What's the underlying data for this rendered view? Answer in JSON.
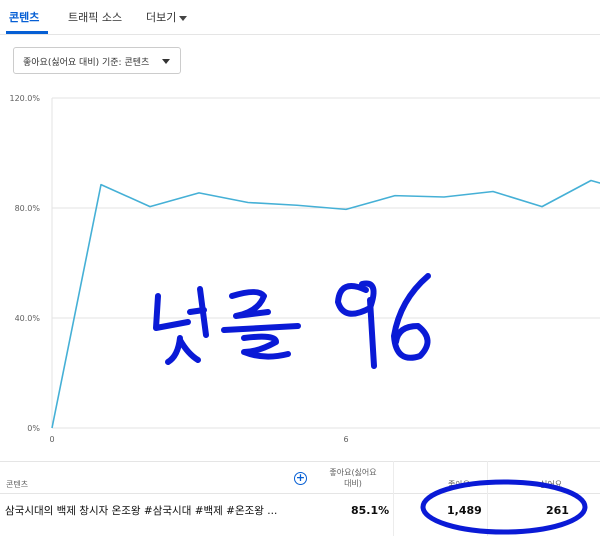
{
  "tabs": [
    {
      "label": "콘텐츠",
      "active": true
    },
    {
      "label": "트래픽 소스"
    },
    {
      "label": "더보기"
    }
  ],
  "dropdown": {
    "label": "좋아요(싫어요 대비) 기준: 콘텐츠"
  },
  "chart_data": {
    "type": "line",
    "x_ticks": [
      "0",
      "6"
    ],
    "y_ticks": [
      "0%",
      "40.0%",
      "80.0%",
      "120.0%"
    ],
    "ylim": [
      0,
      120
    ],
    "x": [
      0,
      1,
      2,
      3,
      4,
      5,
      6,
      7,
      8,
      9,
      10,
      11,
      12
    ],
    "values": [
      0,
      88.5,
      80.5,
      85.5,
      82,
      81,
      79.5,
      84.5,
      84,
      86,
      80.5,
      90,
      85
    ],
    "grid": true,
    "line_color": "#45b0d6"
  },
  "table": {
    "headers": {
      "content": "콘텐츠",
      "likes_ratio_line1": "좋아요(싫어요",
      "likes_ratio_line2": "대비)",
      "likes": "좋아요",
      "dislikes": "싫어요"
    },
    "add_button": "+",
    "row": {
      "title": "삼국시대의 백제 창시자 온조왕 #삼국시대 #백제 #온조왕 ...",
      "likes_ratio": "85.1%",
      "likes": "1,489",
      "dislikes": "261"
    }
  },
  "annotation": {
    "text": "댓글 96",
    "ink_color": "#0a1ad6"
  }
}
